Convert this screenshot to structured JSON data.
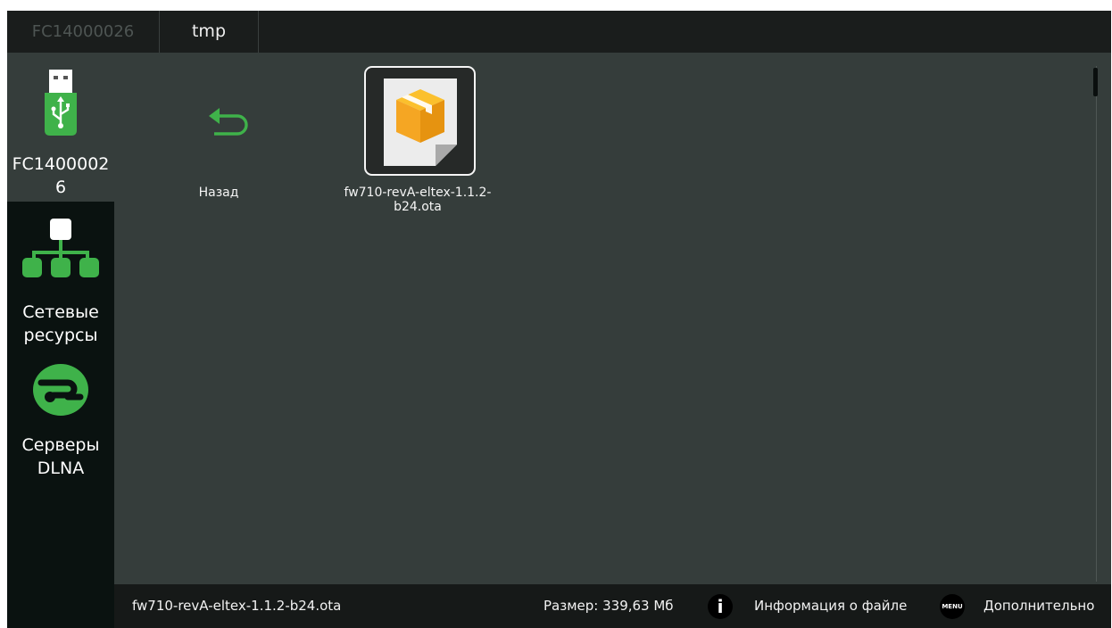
{
  "breadcrumb": {
    "device": "FC14000026",
    "folder": "tmp"
  },
  "sidebar": {
    "items": [
      {
        "label": "FC1400002\n6",
        "icon": "usb-drive-icon",
        "selected": true
      },
      {
        "label": "Сетевые\nресурсы",
        "icon": "network-icon",
        "selected": false
      },
      {
        "label": "Серверы\nDLNA",
        "icon": "dlna-server-icon",
        "selected": false
      }
    ]
  },
  "files": {
    "back": {
      "label": "Назад",
      "icon": "back-arrow-icon"
    },
    "items": [
      {
        "label": "fw710-revA-eltex-1.1.2-\nb24.ota",
        "icon": "package-file-icon",
        "selected": true
      }
    ]
  },
  "status": {
    "filename": "fw710-revA-eltex-1.1.2-b24.ota",
    "size": "Размер: 339,63 Мб",
    "info_icon_label": "i",
    "info_label": "Информация о файле",
    "menu_icon_label": "MENU",
    "more_label": "Дополнительно"
  },
  "colors": {
    "accent": "#3fb24a",
    "folder_icon": "#f5a623",
    "background": "#353d3b",
    "sidebar": "#0a1210"
  }
}
